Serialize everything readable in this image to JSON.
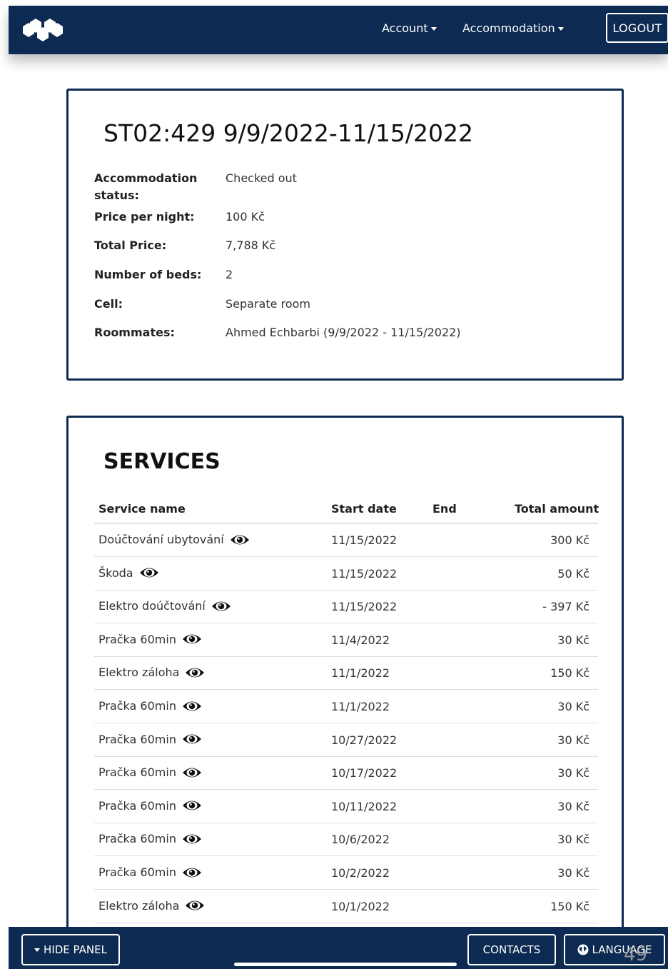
{
  "nav": {
    "account": "Account",
    "accommodation": "Accommodation",
    "logout": "LOGOUT"
  },
  "reservation": {
    "title": "ST02:429 9/9/2022-11/15/2022",
    "details": [
      {
        "label": "Accommodation status:",
        "value": "Checked out"
      },
      {
        "label": "Price per night:",
        "value": "100 Kč"
      },
      {
        "label": "Total Price:",
        "value": "7,788 Kč"
      },
      {
        "label": "Number of beds:",
        "value": "2"
      },
      {
        "label": "Cell:",
        "value": "Separate room"
      },
      {
        "label": "Roommates:",
        "value": "Ahmed Echbarbi (9/9/2022 - 11/15/2022)"
      }
    ]
  },
  "services": {
    "title": "SERVICES",
    "columns": {
      "name": "Service name",
      "start": "Start date",
      "end": "End",
      "amount": "Total amount"
    },
    "rows": [
      {
        "name": "Doúčtování ubytování",
        "start": "11/15/2022",
        "amount": "300 Kč"
      },
      {
        "name": "Škoda",
        "start": "11/15/2022",
        "amount": "50 Kč"
      },
      {
        "name": "Elektro doúčtování",
        "start": "11/15/2022",
        "amount": "- 397 Kč"
      },
      {
        "name": "Pračka 60min",
        "start": "11/4/2022",
        "amount": "30 Kč"
      },
      {
        "name": "Elektro záloha",
        "start": "11/1/2022",
        "amount": "150 Kč"
      },
      {
        "name": "Pračka 60min",
        "start": "11/1/2022",
        "amount": "30 Kč"
      },
      {
        "name": "Pračka 60min",
        "start": "10/27/2022",
        "amount": "30 Kč"
      },
      {
        "name": "Pračka 60min",
        "start": "10/17/2022",
        "amount": "30 Kč"
      },
      {
        "name": "Pračka 60min",
        "start": "10/11/2022",
        "amount": "30 Kč"
      },
      {
        "name": "Pračka 60min",
        "start": "10/6/2022",
        "amount": "30 Kč"
      },
      {
        "name": "Pračka 60min",
        "start": "10/2/2022",
        "amount": "30 Kč"
      },
      {
        "name": "Elektro záloha",
        "start": "10/1/2022",
        "amount": "150 Kč"
      }
    ]
  },
  "footer": {
    "hide_panel": "HIDE PANEL",
    "contacts": "CONTACTS",
    "language": "LANGUAGE",
    "page_number": "49"
  },
  "colors": {
    "navy": "#0d2a52",
    "white": "#ffffff"
  },
  "icons": {
    "logo": "hexagon-cluster-logo",
    "view": "eye-icon",
    "language": "globe-icon",
    "dropdown": "caret-down-icon"
  }
}
